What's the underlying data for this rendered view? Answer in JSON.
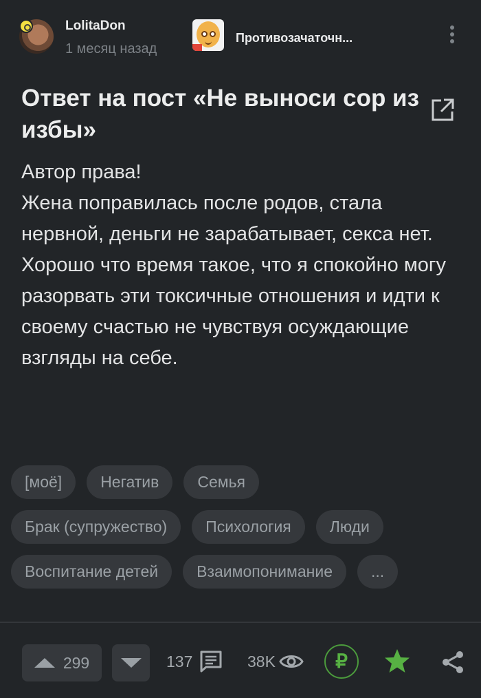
{
  "post": {
    "author": "LolitaDon",
    "time": "1 месяц назад",
    "community": "Противозачаточн...",
    "title": "Ответ на пост «Не выноси сор из избы»",
    "body": "Автор права!\nЖена поправилась после родов, стала нервной, деньги не зарабатывает, секса нет.\nХорошо что время такое, что я спокойно могу разорвать эти токсичные отношения и идти к своему счастью не чувствуя осуждающие взгляды на себе."
  },
  "tags": [
    [
      "[моё]",
      "Негатив",
      "Семья"
    ],
    [
      "Брак (супружество)",
      "Психология",
      "Люди"
    ],
    [
      "Воспитание детей",
      "Взаимопонимание",
      "..."
    ]
  ],
  "footer": {
    "rating": "299",
    "comments": "137",
    "views": "38K"
  },
  "icons": {
    "menu": "more-vertical-icon",
    "open": "open-external-icon",
    "upvote": "arrow-up-icon",
    "downvote": "arrow-down-icon",
    "comments": "comment-icon",
    "views": "eye-icon",
    "donate": "ruble-icon",
    "save": "star-icon",
    "share": "share-icon"
  },
  "colors": {
    "background": "#222528",
    "tag_background": "#35383c",
    "accent_green": "#57b143"
  }
}
